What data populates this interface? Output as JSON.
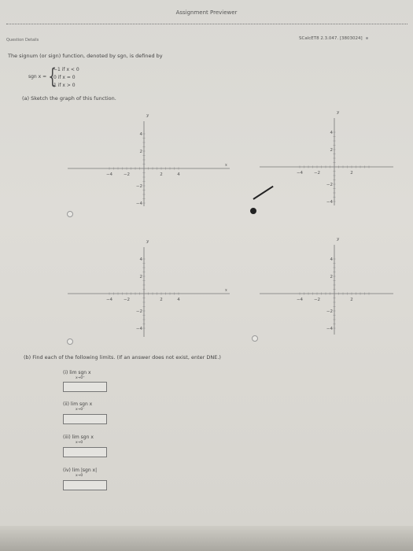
{
  "header": {
    "title": "Assignment Previewer"
  },
  "question": {
    "details_label": "Question Details",
    "reference": "SCalcET8 2.3.047. [3803024]",
    "intro": "The signum (or sign) function, denoted by sgn, is defined by",
    "definition": {
      "lhs": "sgn x =",
      "cases": [
        "−1   if  x < 0",
        "0    if  x = 0",
        "1    if  x > 0"
      ]
    },
    "part_a": "(a) Sketch the graph of this function.",
    "part_b": "(b) Find each of the following limits. (If an answer does not exist, enter DNE.)",
    "limits": [
      {
        "label": "(i)   lim  sgn x",
        "sub": "x→0⁺",
        "value": ""
      },
      {
        "label": "(ii)   lim  sgn x",
        "sub": "x→0⁻",
        "value": ""
      },
      {
        "label": "(iii)  lim  sgn x",
        "sub": "x→0",
        "value": ""
      },
      {
        "label": "(iv)  lim  |sgn x|",
        "sub": "x→0",
        "value": ""
      }
    ]
  },
  "graphs": [
    {
      "x_label": "x",
      "y_label": "y",
      "x_ticks": [
        "−4",
        "−2",
        "2",
        "4"
      ],
      "y_ticks": [
        "4",
        "2",
        "−2",
        "−4"
      ],
      "selected": false
    },
    {
      "x_label": "",
      "y_label": "y",
      "x_ticks": [
        "−4",
        "−2",
        "2"
      ],
      "y_ticks": [
        "4",
        "2",
        "−2",
        "−4"
      ],
      "selected": true
    },
    {
      "x_label": "x",
      "y_label": "y",
      "x_ticks": [
        "−4",
        "−2",
        "2",
        "4"
      ],
      "y_ticks": [
        "4",
        "2",
        "−2",
        "−4"
      ],
      "selected": false
    },
    {
      "x_label": "",
      "y_label": "y",
      "x_ticks": [
        "−4",
        "−2",
        "2"
      ],
      "y_ticks": [
        "4",
        "2",
        "−2",
        "−4"
      ],
      "selected": false
    }
  ]
}
